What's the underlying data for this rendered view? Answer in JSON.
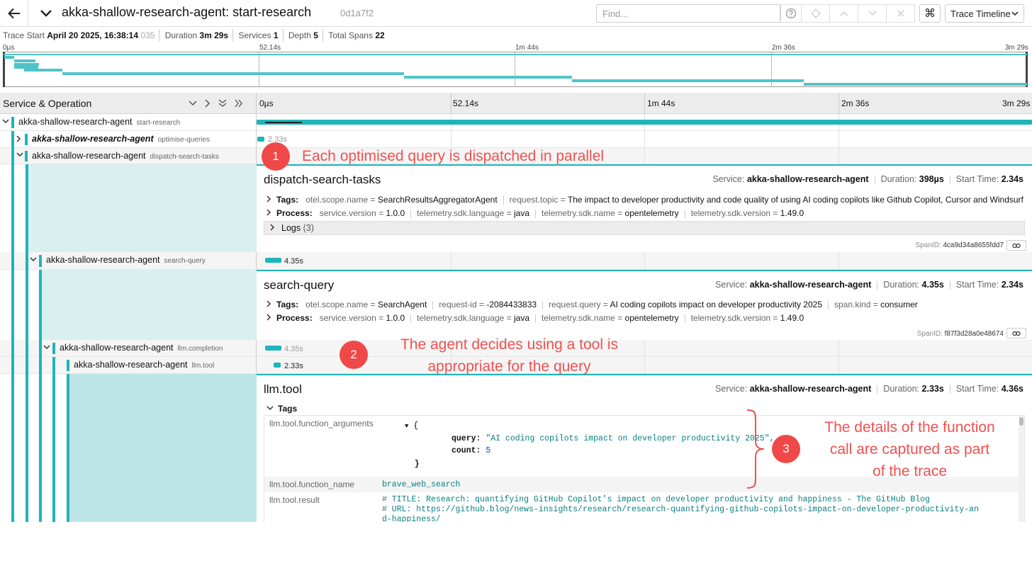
{
  "header": {
    "title": "akka-shallow-research-agent: start-research",
    "trace_id": "0d1a7f2",
    "find_placeholder": "Find...",
    "keyboard_symbol": "⌘",
    "view_select": "Trace Timeline"
  },
  "summary": {
    "trace_start_label": "Trace Start",
    "trace_start_value": "April 20 2025, 16:38:14",
    "trace_start_ms": ".035",
    "duration_label": "Duration",
    "duration_value": "3m 29s",
    "services_label": "Services",
    "services_value": "1",
    "depth_label": "Depth",
    "depth_value": "5",
    "total_spans_label": "Total Spans",
    "total_spans_value": "22"
  },
  "minimap_ticks": [
    "0µs",
    "52.14s",
    "1m 44s",
    "2m 36s",
    "3m 29s"
  ],
  "columns": {
    "title": "Service & Operation",
    "ticks": [
      "0µs",
      "52.14s",
      "1m 44s",
      "2m 36s",
      "3m 29s"
    ]
  },
  "rows": [
    {
      "service": "akka-shallow-research-agent",
      "operation": "start-research"
    },
    {
      "service": "akka-shallow-research-agent",
      "operation": "optimise-queries",
      "duration": "2.33s"
    },
    {
      "service": "akka-shallow-research-agent",
      "operation": "dispatch-search-tasks"
    },
    {
      "service": "akka-shallow-research-agent",
      "operation": "search-query",
      "duration": "4.35s"
    },
    {
      "service": "akka-shallow-research-agent",
      "operation": "llm.completion",
      "duration": "4.35s"
    },
    {
      "service": "akka-shallow-research-agent",
      "operation": "llm.tool",
      "duration": "2.33s"
    }
  ],
  "details": {
    "dispatch": {
      "title": "dispatch-search-tasks",
      "service_label": "Service:",
      "service": "akka-shallow-research-agent",
      "duration_label": "Duration:",
      "duration": "398µs",
      "start_label": "Start Time:",
      "start": "2.34s",
      "tags_label": "Tags:",
      "tags": [
        {
          "k": "otel.scope.name",
          "v": "SearchResultsAggregatorAgent"
        },
        {
          "k": "request.topic",
          "v": "The impact to developer productivity and code quality of using AI coding copilots like Github Copilot, Cursor and Windsurf I..."
        }
      ],
      "process_label": "Process:",
      "process": [
        {
          "k": "service.version",
          "v": "1.0.0"
        },
        {
          "k": "telemetry.sdk.language",
          "v": "java"
        },
        {
          "k": "telemetry.sdk.name",
          "v": "opentelemetry"
        },
        {
          "k": "telemetry.sdk.version",
          "v": "1.49.0"
        }
      ],
      "logs_label": "Logs",
      "logs_count": "(3)",
      "spanid_label": "SpanID:",
      "spanid": "4ca9d34a8655fdd7"
    },
    "search": {
      "title": "search-query",
      "service_label": "Service:",
      "service": "akka-shallow-research-agent",
      "duration_label": "Duration:",
      "duration": "4.35s",
      "start_label": "Start Time:",
      "start": "2.34s",
      "tags_label": "Tags:",
      "tags": [
        {
          "k": "otel.scope.name",
          "v": "SearchAgent"
        },
        {
          "k": "request-id",
          "v": "-2084433833"
        },
        {
          "k": "request.query",
          "v": "AI coding copilots impact on developer productivity 2025"
        },
        {
          "k": "span.kind",
          "v": "consumer"
        }
      ],
      "process_label": "Process:",
      "process": [
        {
          "k": "service.version",
          "v": "1.0.0"
        },
        {
          "k": "telemetry.sdk.language",
          "v": "java"
        },
        {
          "k": "telemetry.sdk.name",
          "v": "opentelemetry"
        },
        {
          "k": "telemetry.sdk.version",
          "v": "1.49.0"
        }
      ],
      "spanid_label": "SpanID:",
      "spanid": "f87f3d28a0e48674"
    },
    "tool": {
      "title": "llm.tool",
      "service_label": "Service:",
      "service": "akka-shallow-research-agent",
      "duration_label": "Duration:",
      "duration": "2.33s",
      "start_label": "Start Time:",
      "start": "4.36s",
      "tags_label": "Tags",
      "args_key": "llm.tool.function_arguments",
      "args_query_key": "query:",
      "args_query_value": "\"AI coding copilots impact on developer productivity 2025\",",
      "args_count_key": "count:",
      "args_count_value": "5",
      "name_key": "llm.tool.function_name",
      "name_value": "brave_web_search",
      "result_key": "llm.tool.result",
      "result_lines": [
        "# TITLE: Research: quantifying GitHub Copilot’s impact on developer productivity and happiness - The GitHub Blog",
        "# URL: https://github.blog/news-insights/research/research-quantifying-github-copilots-impact-on-developer-productivity-an",
        "d-happiness/"
      ]
    }
  },
  "annotations": {
    "one_number": "1",
    "one_text": "Each optimised query is dispatched in parallel",
    "two_number": "2",
    "two_line1": "The agent decides using a tool is",
    "two_line2": "appropriate for the query",
    "three_number": "3",
    "three_line1": "The details of the function",
    "three_line2": "call are captured as part",
    "three_line3": "of the trace"
  },
  "colors": {
    "accent": "#1eb5b9",
    "annotation": "#f04848"
  }
}
